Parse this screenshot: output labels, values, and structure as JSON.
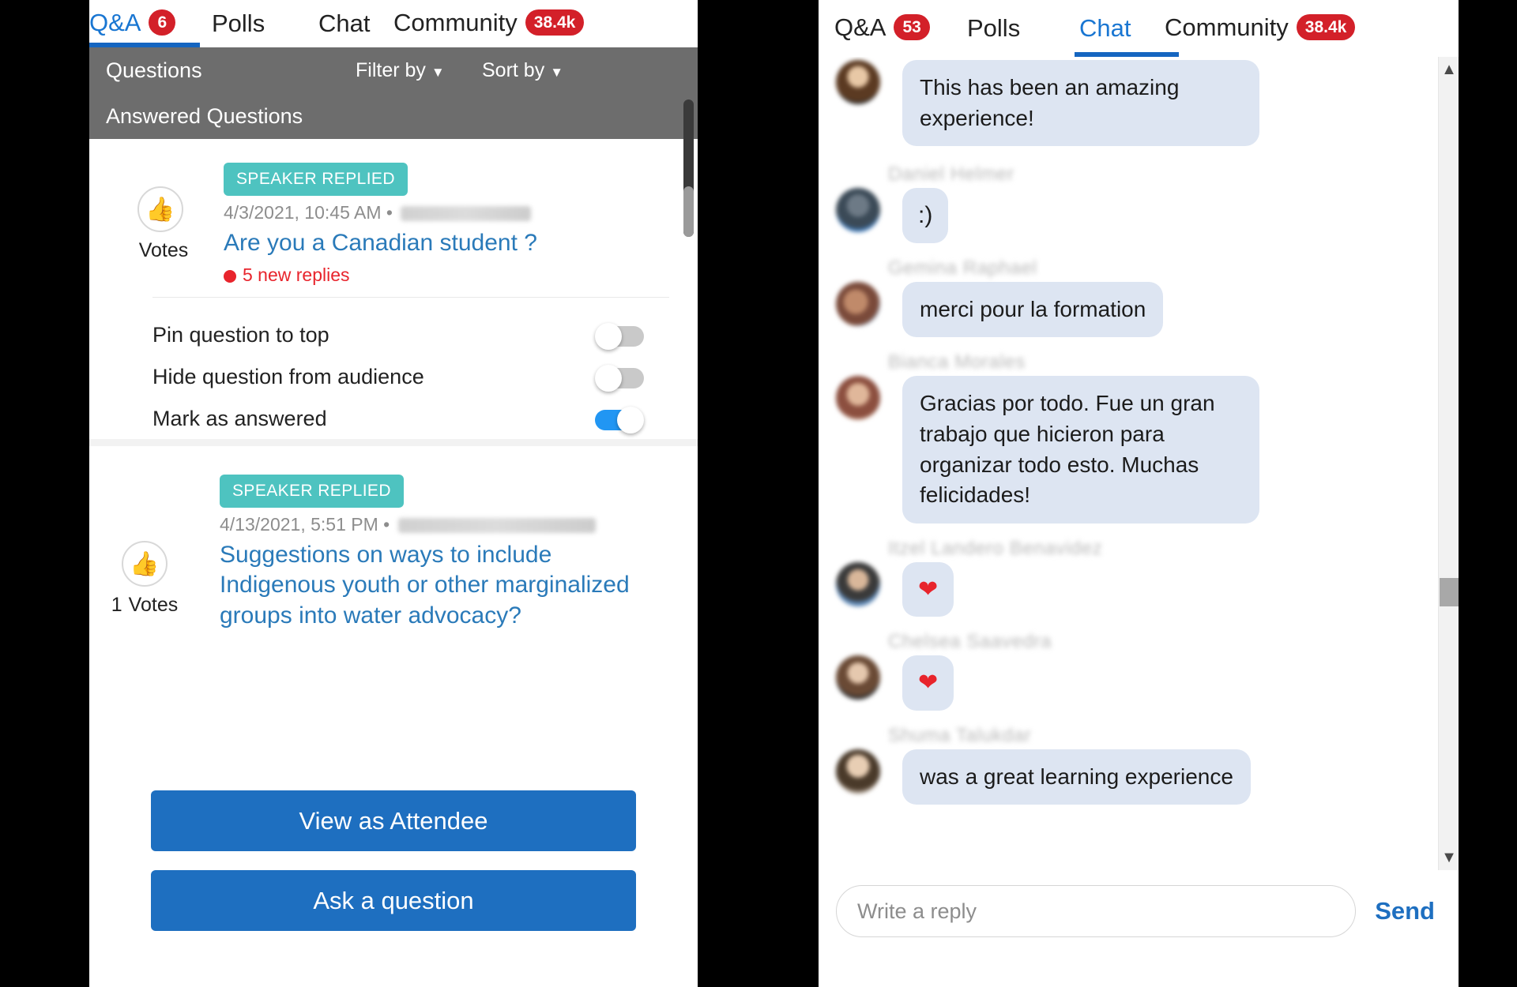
{
  "colors": {
    "accent_blue": "#1565c0",
    "link_blue": "#2a7ab9",
    "badge_red": "#d32029",
    "chip_teal": "#4ec3c0",
    "button_blue": "#1e6fc0",
    "toggle_on": "#2196f3",
    "bubble_bg": "#dde5f2",
    "subheader_gray": "#6d6d6d",
    "alert_red": "#e8242c"
  },
  "qa_panel": {
    "tabs": [
      {
        "label": "Q&A",
        "badge": "6",
        "active": true
      },
      {
        "label": "Polls",
        "badge": "",
        "active": false
      },
      {
        "label": "Chat",
        "badge": "",
        "active": false
      },
      {
        "label": "Community",
        "badge": "38.4k",
        "active": false
      }
    ],
    "subheader": {
      "title": "Questions",
      "filter_label": "Filter by",
      "sort_label": "Sort by",
      "answered_label": "Answered Questions",
      "caret_icon": "chevron-down-icon"
    },
    "questions": [
      {
        "status_chip": "SPEAKER REPLIED",
        "timestamp": "4/3/2021, 10:45 AM",
        "separator": "•",
        "author": "",
        "author_redacted": true,
        "title": "Are you a Canadian student ?",
        "new_replies": "5 new replies",
        "votes_count": "",
        "votes_label": "Votes",
        "thumb_icon": "thumbs-up-icon",
        "options": [
          {
            "label": "Pin question to top",
            "on": false
          },
          {
            "label": "Hide question from audience",
            "on": false
          },
          {
            "label": "Mark as answered",
            "on": true
          }
        ]
      },
      {
        "status_chip": "SPEAKER REPLIED",
        "timestamp": "4/13/2021, 5:51 PM",
        "separator": "•",
        "author": "",
        "author_redacted": true,
        "title": "Suggestions on ways to include Indigenous youth or other marginalized groups into water advocacy?",
        "new_replies": "",
        "votes_count": "1",
        "votes_label": "Votes",
        "thumb_icon": "thumbs-up-icon",
        "options": []
      }
    ],
    "actions": {
      "view_as_attendee": "View as Attendee",
      "ask_a_question": "Ask a question"
    }
  },
  "chat_panel": {
    "tabs": [
      {
        "label": "Q&A",
        "badge": "53",
        "active": false
      },
      {
        "label": "Polls",
        "badge": "",
        "active": false
      },
      {
        "label": "Chat",
        "badge": "",
        "active": true
      },
      {
        "label": "Community",
        "badge": "38.4k",
        "active": false
      }
    ],
    "messages": [
      {
        "name": "",
        "name_redacted": false,
        "show_name": false,
        "text": "This has been an amazing experience!",
        "kind": "text"
      },
      {
        "name": "Daniel Helmer",
        "name_redacted": true,
        "show_name": true,
        "text": ":)",
        "kind": "emoji"
      },
      {
        "name": "Gemina Raphael",
        "name_redacted": true,
        "show_name": true,
        "text": "merci pour la formation",
        "kind": "text"
      },
      {
        "name": "Bianca Morales",
        "name_redacted": true,
        "show_name": true,
        "text": "Gracias por todo. Fue un gran trabajo que hicieron para organizar todo esto. Muchas felicidades!",
        "kind": "text"
      },
      {
        "name": "Itzel Landero Benavidez",
        "name_redacted": true,
        "show_name": true,
        "text": "❤",
        "kind": "heart"
      },
      {
        "name": "Chelsea Saavedra",
        "name_redacted": true,
        "show_name": true,
        "text": "❤",
        "kind": "heart"
      },
      {
        "name": "Shuma Talukdar",
        "name_redacted": true,
        "show_name": true,
        "text": "was a great learning experience",
        "kind": "text"
      }
    ],
    "composer": {
      "placeholder": "Write a reply",
      "value": "",
      "send_label": "Send"
    },
    "scrollbar": {
      "up_icon": "chevron-up-icon",
      "down_icon": "chevron-down-icon"
    }
  }
}
